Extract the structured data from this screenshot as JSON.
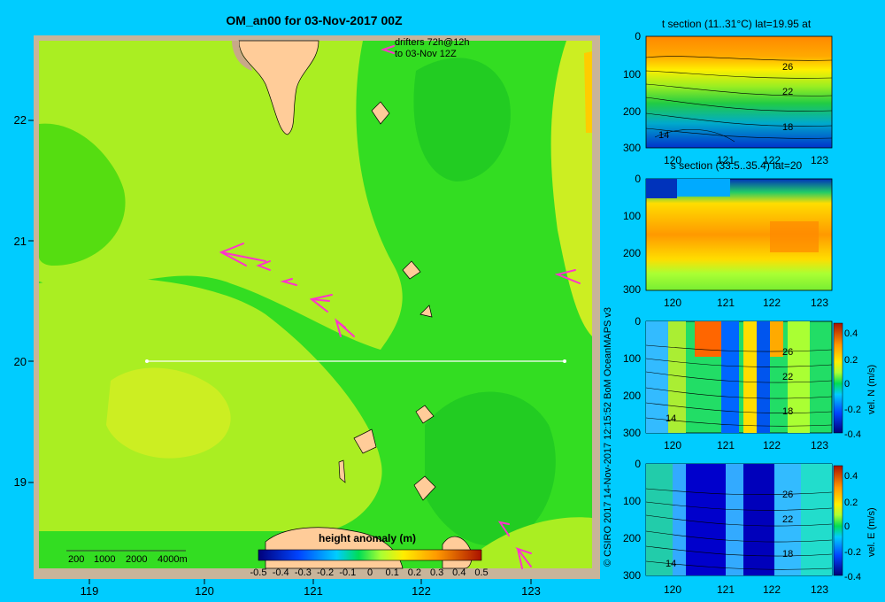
{
  "title": "OM_an00 for 03-Nov-2017 00Z",
  "drifters_label_1": "drifters 72h@12h",
  "drifters_label_2": "to 03-Nov 12Z",
  "main_map": {
    "x_ticks": [
      "119",
      "120",
      "121",
      "122",
      "123"
    ],
    "y_ticks": [
      "22",
      "21",
      "20",
      "19"
    ],
    "depth_legend": [
      "200",
      "1000",
      "2000",
      "4000m"
    ],
    "colorbar_title": "height anomaly (m)",
    "colorbar_ticks": [
      "-0.5",
      "-0.4",
      "-0.3",
      "-0.2",
      "-0.1",
      "0",
      "0.1",
      "0.2",
      "0.3",
      "0.4",
      "0.5"
    ]
  },
  "section_panels": [
    {
      "title": "t section (11..31°C) lat=19.95 at",
      "contours": [
        "26",
        "22",
        "18",
        "14"
      ]
    },
    {
      "title": "s section (33.5..35.4) lat=20",
      "contours": []
    },
    {
      "title": "",
      "contours": [
        "26",
        "22",
        "18",
        "14"
      ],
      "colorbar_label": "vel. N (m/s)"
    },
    {
      "title": "",
      "contours": [
        "26",
        "22",
        "18",
        "14"
      ],
      "colorbar_label": "vel. E (m/s)"
    }
  ],
  "section_x_ticks": [
    "120",
    "121",
    "122",
    "123"
  ],
  "section_y_ticks": [
    "0",
    "100",
    "200",
    "300"
  ],
  "panel_colorbar_ticks": [
    "0.4",
    "0.2",
    "0",
    "-0.2",
    "-0.4"
  ],
  "credit": "© CSIRO 2017  14-Nov-2017 12:15:52 BoM OceanMAPS v3",
  "colors": {
    "background": "#00ccff",
    "map_border": "#c8b49a",
    "land": "#ffcc99",
    "drifter": "#ff33cc"
  }
}
